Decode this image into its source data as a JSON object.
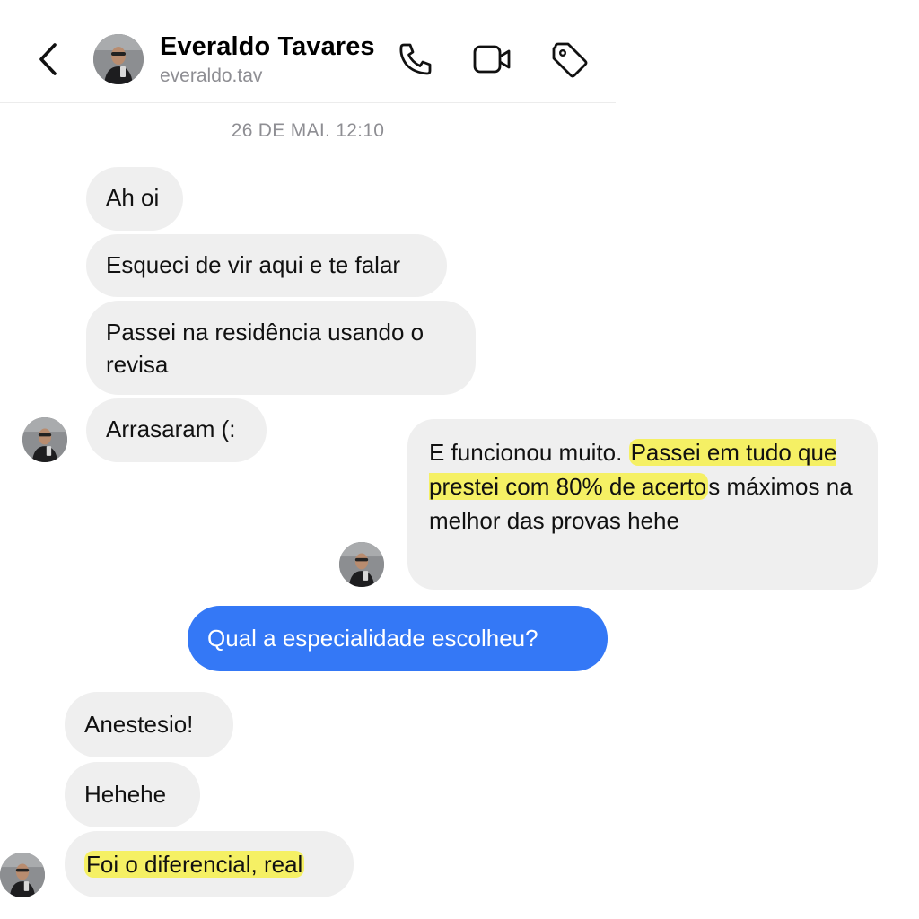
{
  "header": {
    "contact_name": "Everaldo Tavares",
    "contact_handle": "everaldo.tav",
    "icons": [
      "chevron-left-icon",
      "phone-icon",
      "video-camera-icon",
      "tag-icon"
    ]
  },
  "conversation": {
    "timestamp": "26 DE MAI. 12:10",
    "messages": [
      {
        "from": "contact",
        "text": "Ah oi"
      },
      {
        "from": "contact",
        "text": "Esqueci de vir aqui e te falar"
      },
      {
        "from": "contact",
        "text": "Passei na residência usando o revisa"
      },
      {
        "from": "contact",
        "text": "Arrasaram (:"
      },
      {
        "from": "contact",
        "text_parts": {
          "pre": "E funcionou muito. ",
          "highlight": "Passei em tudo que prestei com 80% de acerto",
          "post": "s máximos na melhor das provas hehe"
        }
      },
      {
        "from": "me",
        "text": "Qual a especialidade escolheu?"
      },
      {
        "from": "contact",
        "text": "Anestesio!"
      },
      {
        "from": "contact",
        "text": "Hehehe"
      },
      {
        "from": "contact",
        "text": "Foi o diferencial, real",
        "highlighted": true
      }
    ]
  },
  "colors": {
    "incoming_bubble": "#efefef",
    "outgoing_bubble": "#3478f6",
    "highlight": "#f6f04b",
    "secondary_text": "#8e8e93"
  }
}
